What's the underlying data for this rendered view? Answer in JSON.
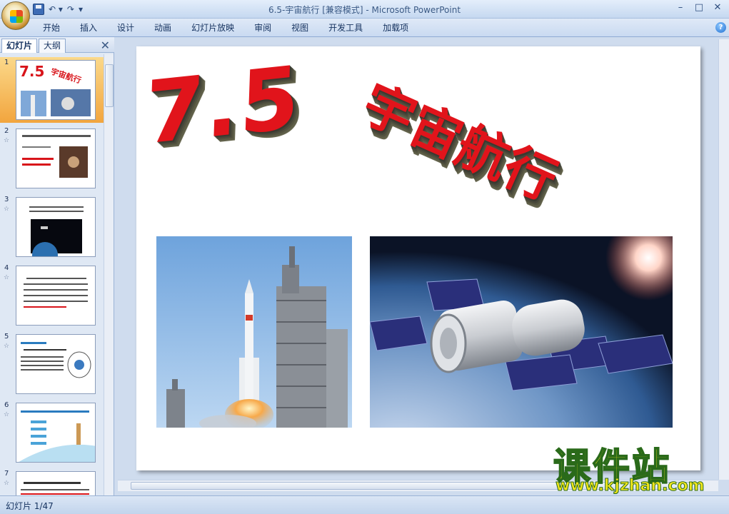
{
  "window": {
    "doc_title": "6.5-宇宙航行 [兼容模式] - ",
    "app_name": "Microsoft PowerPoint",
    "minimize": "–",
    "maximize": "□",
    "close": "✕"
  },
  "qat": {
    "undo": "↶ ▾",
    "redo": "↷",
    "more": "▾"
  },
  "ribbon": {
    "tabs": [
      "开始",
      "插入",
      "设计",
      "动画",
      "幻灯片放映",
      "审阅",
      "视图",
      "开发工具",
      "加载项"
    ]
  },
  "pane": {
    "tab_slides": "幻灯片",
    "tab_outline": "大纲",
    "close": "✕"
  },
  "thumbnails": [
    {
      "num": "1",
      "selected": true
    },
    {
      "num": "2",
      "star": "☆"
    },
    {
      "num": "3",
      "star": "☆"
    },
    {
      "num": "4",
      "star": "☆"
    },
    {
      "num": "5",
      "star": "☆"
    },
    {
      "num": "6",
      "star": "☆"
    },
    {
      "num": "7",
      "star": "☆"
    }
  ],
  "slide": {
    "number_text": "7.5",
    "title_text": "宇宙航行"
  },
  "status": {
    "slide_counter": "幻灯片 1/47"
  },
  "watermark": {
    "cn": "课件站",
    "url": "www.kjzhan.com"
  },
  "colors": {
    "title_red": "#e1141b",
    "selection_orange": "#f2a53e"
  }
}
